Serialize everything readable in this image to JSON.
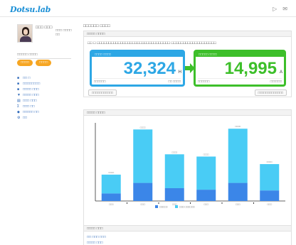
{
  "app": {
    "logo": "Dotsu.lab",
    "header_icons": [
      "▷",
      "✉"
    ]
  },
  "user": {
    "name": "□□□ □□□",
    "info": "□□□ □□□□ □□"
  },
  "sidebar": {
    "section_label": "□□□□□ □□□□",
    "tags": [
      "□□□□",
      "□□□□"
    ],
    "items": [
      {
        "icon": "■",
        "label": "□□ □"
      },
      {
        "icon": "■",
        "label": "□□□□□□□□"
      },
      {
        "icon": "■",
        "label": "□□□□ □□□"
      },
      {
        "icon": "▼",
        "label": "□□□□ □□□"
      },
      {
        "icon": "▤",
        "label": "□□□ □□□"
      },
      {
        "icon": "Σ",
        "label": "□□□ □□"
      },
      {
        "icon": "◆",
        "label": "□□□□□ □□"
      },
      {
        "icon": "⚙",
        "label": "□□"
      }
    ]
  },
  "main": {
    "title": "□□□□□□ □□□□",
    "summary": {
      "header": "□□□□ □□□□",
      "description": "□□ □ □□□□□□□□□□□□□□□□□□□□□□□□□□□□□□□ □□□□□□□□□□□□□□□□□□□",
      "left": {
        "header": "□□□□ □□□□",
        "value": "32,324",
        "unit": "H",
        "foot_left": "□□□□□□",
        "foot_right": "□□ □□□□"
      },
      "right": {
        "header": "□□□□□ □□□□",
        "value": "14,995",
        "unit": "A",
        "foot_left": "□□□□□□",
        "foot_right": "□□□□□□"
      },
      "btn_left": "□□□□□□□□□□□",
      "btn_right": "□□□□□□□□□□□□□"
    },
    "chart_panel": {
      "header": "□□□□ □□□□"
    },
    "bottom_panel": {
      "header": "□□□□ □□□",
      "lines": [
        "□□ □□□ □□□",
        "□□□□ □□□"
      ]
    }
  },
  "chart_data": {
    "type": "bar",
    "categories": [
      "□□□",
      "□□□",
      "□□□",
      "□□□",
      "□□□",
      "□□□"
    ],
    "series": [
      {
        "name": "□□□□□",
        "color": "#3b86e8",
        "values": [
          10,
          24,
          17,
          15,
          24,
          14
        ]
      },
      {
        "name": "□□□ □□□□□□",
        "color": "#49ccf5",
        "values": [
          25,
          71,
          45,
          44,
          72,
          35
        ]
      }
    ],
    "data_labels": [
      "□□□□",
      "□□□□",
      "□□□□",
      "□□□□",
      "□□□□",
      "□□□□"
    ],
    "ylim": [
      0,
      100
    ],
    "legend": "bottom"
  }
}
